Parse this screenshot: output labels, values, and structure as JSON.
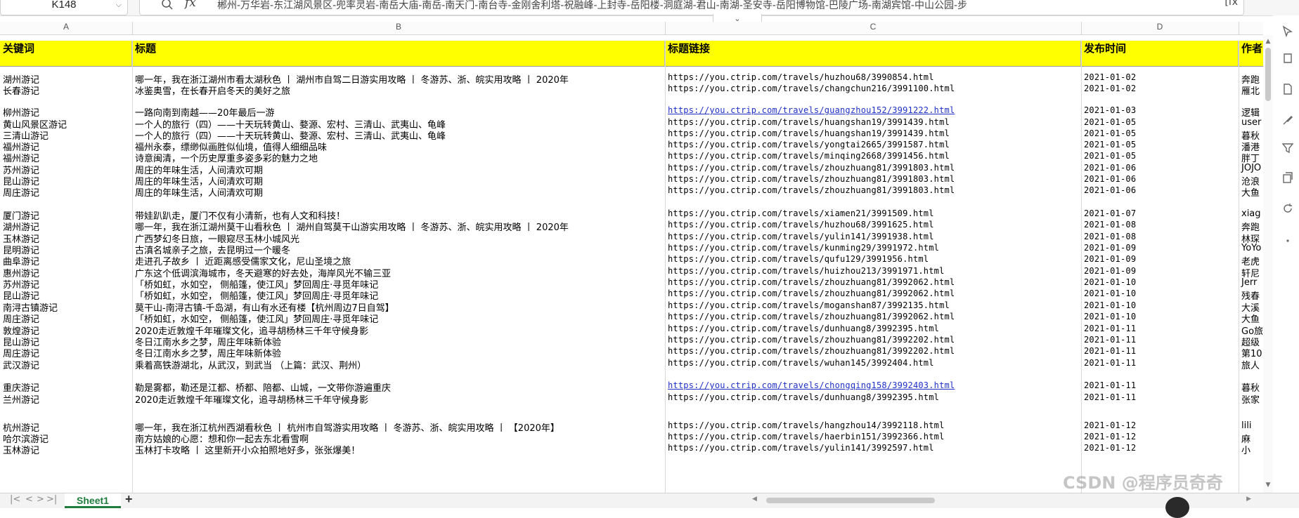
{
  "name_box": "K148",
  "formula_label": "fx",
  "formula_content": "郴州-万华岩-东江湖风景区-兜率灵岩-南岳大庙-南岳-南天门-南台寺-金刚舍利塔-祝融峰-上封寺-岳阳楼-洞庭湖-君山-南湖-圣安寺-岳阳博物馆-巴陵广场-南湖宾馆-中山公园-步",
  "formula_right": "[fx",
  "columns": [
    "A",
    "B",
    "C",
    "D"
  ],
  "headers": {
    "a": "关键词",
    "b": "标题",
    "c": "标题链接",
    "d": "发布时间",
    "e": "作者"
  },
  "rows": [
    {
      "a": "湖州游记",
      "b": "哪一年，我在浙江湖州市看太湖秋色 丨 湖州市自驾二日游实用攻略 丨 冬游苏、浙、皖实用攻略 丨 2020年",
      "c": "https://you.ctrip.com/travels/huzhou68/3990854.html",
      "d": "2021-01-02",
      "e": "奔跑"
    },
    {
      "a": "长春游记",
      "b": "冰鉴奥雪，在长春开启冬天的美好之旅",
      "c": "https://you.ctrip.com/travels/changchun216/3991100.html",
      "d": "2021-01-02",
      "e": "雁北"
    },
    {
      "a": "柳州游记",
      "b": "一路向南到南越——20年最后一游",
      "c": "https://you.ctrip.com/travels/guangzhou152/3991222.html",
      "d": "2021-01-03",
      "e": "逻辑",
      "link": true
    },
    {
      "a": "黄山风景区游记",
      "b": "一个人的旅行（四）——十天玩转黄山、婺源、宏村、三清山、武夷山、龟峰",
      "c": "https://you.ctrip.com/travels/huangshan19/3991439.html",
      "d": "2021-01-05",
      "e": "user"
    },
    {
      "a": "三清山游记",
      "b": "一个人的旅行（四）——十天玩转黄山、婺源、宏村、三清山、武夷山、龟峰",
      "c": "https://you.ctrip.com/travels/huangshan19/3991439.html",
      "d": "2021-01-05",
      "e": "暮秋"
    },
    {
      "a": "福州游记",
      "b": "福州永泰，缥缈似画胜似仙境，值得人细细品味",
      "c": "https://you.ctrip.com/travels/yongtai2665/3991587.html",
      "d": "2021-01-05",
      "e": "潘港"
    },
    {
      "a": "福州游记",
      "b": "诗意闽清，一个历史厚重多姿多彩的魅力之地",
      "c": "https://you.ctrip.com/travels/minqing2668/3991456.html",
      "d": "2021-01-05",
      "e": "胖丁"
    },
    {
      "a": "苏州游记",
      "b": "周庄的年味生活，人间清欢可期",
      "c": "https://you.ctrip.com/travels/zhouzhuang81/3991803.html",
      "d": "2021-01-06",
      "e": "JOJO"
    },
    {
      "a": "昆山游记",
      "b": "周庄的年味生活，人间清欢可期",
      "c": "https://you.ctrip.com/travels/zhouzhuang81/3991803.html",
      "d": "2021-01-06",
      "e": "沧浪"
    },
    {
      "a": "周庄游记",
      "b": "周庄的年味生活，人间清欢可期",
      "c": "https://you.ctrip.com/travels/zhouzhuang81/3991803.html",
      "d": "2021-01-06",
      "e": "大鱼"
    },
    {
      "a": "厦门游记",
      "b": "带娃趴趴走，厦门不仅有小清新，也有人文和科技！",
      "c": "https://you.ctrip.com/travels/xiamen21/3991509.html",
      "d": "2021-01-07",
      "e": "xiag"
    },
    {
      "a": "湖州游记",
      "b": "哪一年，我在浙江湖州莫干山看秋色 丨 湖州自驾莫干山游实用攻略 丨 冬游苏、浙、皖实用攻略 丨 2020年",
      "c": "https://you.ctrip.com/travels/huzhou68/3991625.html",
      "d": "2021-01-08",
      "e": "奔跑"
    },
    {
      "a": "玉林游记",
      "b": "广西梦幻冬日旅，一眼窥尽玉林小城风光",
      "c": "https://you.ctrip.com/travels/yulin141/3991938.html",
      "d": "2021-01-08",
      "e": "林琛"
    },
    {
      "a": "昆明游记",
      "b": "古滇名城亲子之旅，去昆明过一个暖冬",
      "c": "https://you.ctrip.com/travels/kunming29/3991972.html",
      "d": "2021-01-09",
      "e": "YoYo"
    },
    {
      "a": "曲阜游记",
      "b": "走进孔子故乡 丨 近距离感受儒家文化，尼山圣境之旅",
      "c": "https://you.ctrip.com/travels/qufu129/3991956.html",
      "d": "2021-01-09",
      "e": "老虎"
    },
    {
      "a": "惠州游记",
      "b": "广东这个低调滨海城市，冬天避寒的好去处，海岸风光不输三亚",
      "c": "https://you.ctrip.com/travels/huizhou213/3991971.html",
      "d": "2021-01-09",
      "e": "轩尼"
    },
    {
      "a": "苏州游记",
      "b": "「桥如虹，水如空， 侧船篷，使江风」梦回周庄·寻觅年味记",
      "c": "https://you.ctrip.com/travels/zhouzhuang81/3992062.html",
      "d": "2021-01-10",
      "e": "Jerr"
    },
    {
      "a": "昆山游记",
      "b": "「桥如虹，水如空， 侧船篷，使江风」梦回周庄·寻觅年味记",
      "c": "https://you.ctrip.com/travels/zhouzhuang81/3992062.html",
      "d": "2021-01-10",
      "e": "残春"
    },
    {
      "a": "南浔古镇游记",
      "b": "莫干山-南浔古镇-千岛湖，有山有水还有楼【杭州周边7日自驾】",
      "c": "https://you.ctrip.com/travels/moganshan87/3992135.html",
      "d": "2021-01-10",
      "e": "大溪"
    },
    {
      "a": "周庄游记",
      "b": "「桥如虹，水如空， 侧船篷，使江风」梦回周庄·寻觅年味记",
      "c": "https://you.ctrip.com/travels/zhouzhuang81/3992062.html",
      "d": "2021-01-10",
      "e": "大鱼"
    },
    {
      "a": "敦煌游记",
      "b": "2020走近敦煌千年璀璨文化，追寻胡杨林三千年守候身影",
      "c": "https://you.ctrip.com/travels/dunhuang8/3992395.html",
      "d": "2021-01-11",
      "e": "Go旅"
    },
    {
      "a": "昆山游记",
      "b": "冬日江南水乡之梦，周庄年味新体验",
      "c": "https://you.ctrip.com/travels/zhouzhuang81/3992202.html",
      "d": "2021-01-11",
      "e": "超级"
    },
    {
      "a": "周庄游记",
      "b": "冬日江南水乡之梦，周庄年味新体验",
      "c": "https://you.ctrip.com/travels/zhouzhuang81/3992202.html",
      "d": "2021-01-11",
      "e": "第10"
    },
    {
      "a": "武汉游记",
      "b": "乘着高铁游湖北，从武汉，到武当 （上篇：武汉、荆州）",
      "c": "https://you.ctrip.com/travels/wuhan145/3992404.html",
      "d": "2021-01-11",
      "e": "旅人"
    },
    {
      "a": "重庆游记",
      "b": "勒是雾都，勒还是江都、桥都、陪都、山城，一文带你游遍重庆",
      "c": "https://you.ctrip.com/travels/chongqing158/3992403.html",
      "d": "2021-01-11",
      "e": "暮秋",
      "link": true
    },
    {
      "a": "兰州游记",
      "b": "2020走近敦煌千年璀璨文化，追寻胡杨林三千年守候身影",
      "c": "https://you.ctrip.com/travels/dunhuang8/3992395.html",
      "d": "2021-01-11",
      "e": "张家"
    },
    {
      "a": "杭州游记",
      "b": "哪一年，我在浙江杭州西湖看秋色 丨 杭州市自驾游实用攻略 丨 冬游苏、浙、皖实用攻略 丨 【2020年】",
      "c": "https://you.ctrip.com/travels/hangzhou14/3992118.html",
      "d": "2021-01-12",
      "e": "lili"
    },
    {
      "a": "哈尔滨游记",
      "b": "南方姑娘的心愿：想和你一起去东北看雪啊",
      "c": "https://you.ctrip.com/travels/haerbin151/3992366.html",
      "d": "2021-01-12",
      "e": "麻"
    },
    {
      "a": "玉林游记",
      "b": "玉林打卡攻略 丨 这里新开小众拍照地好多，张张爆美！",
      "c": "https://you.ctrip.com/travels/yulin141/3992597.html",
      "d": "2021-01-12",
      "e": "小"
    }
  ],
  "sheet_tab": "Sheet1",
  "add_sheet": "+",
  "watermark": "CSDN @程序员奇奇"
}
